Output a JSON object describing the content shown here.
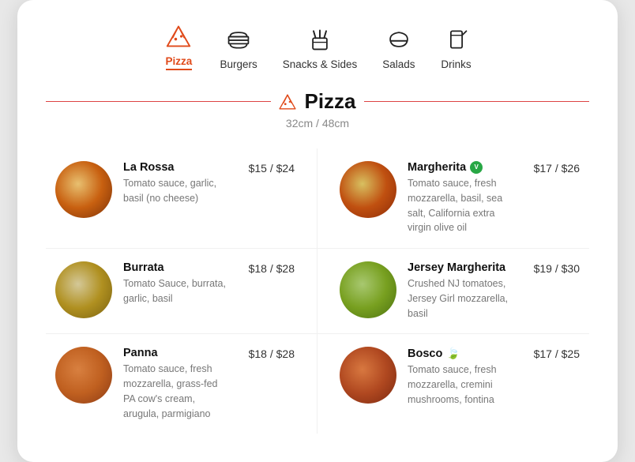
{
  "nav": {
    "items": [
      {
        "id": "pizza",
        "label": "Pizza",
        "active": true
      },
      {
        "id": "burgers",
        "label": "Burgers",
        "active": false
      },
      {
        "id": "snacks",
        "label": "Snacks & Sides",
        "active": false
      },
      {
        "id": "salads",
        "label": "Salads",
        "active": false
      },
      {
        "id": "drinks",
        "label": "Drinks",
        "active": false
      }
    ]
  },
  "section": {
    "title": "Pizza",
    "subtitle": "32cm / 48cm"
  },
  "menu": {
    "items": [
      {
        "id": "la-rossa",
        "name": "La Rossa",
        "description": "Tomato sauce, garlic, basil (no cheese)",
        "price": "$15 / $24",
        "badge": null,
        "image_class": "pizza-la-rossa"
      },
      {
        "id": "margherita",
        "name": "Margherita",
        "description": "Tomato sauce, fresh mozzarella, basil, sea salt, California extra virgin olive oil",
        "price": "$17 / $26",
        "badge": "v",
        "image_class": "pizza-margherita"
      },
      {
        "id": "burrata",
        "name": "Burrata",
        "description": "Tomato Sauce, burrata, garlic, basil",
        "price": "$18 / $28",
        "badge": null,
        "image_class": "pizza-burrata"
      },
      {
        "id": "jersey-margherita",
        "name": "Jersey Margherita",
        "description": "Crushed NJ tomatoes, Jersey Girl mozzarella, basil",
        "price": "$19 / $30",
        "badge": null,
        "image_class": "pizza-jersey"
      },
      {
        "id": "panna",
        "name": "Panna",
        "description": "Tomato sauce, fresh mozzarella, grass-fed PA cow's cream, arugula, parmigiano",
        "price": "$18 / $28",
        "badge": null,
        "image_class": "pizza-panna"
      },
      {
        "id": "bosco",
        "name": "Bosco",
        "description": "Tomato sauce, fresh mozzarella, cremini mushrooms, fontina",
        "price": "$17 / $25",
        "badge": "leaf",
        "image_class": "pizza-bosco"
      }
    ]
  }
}
